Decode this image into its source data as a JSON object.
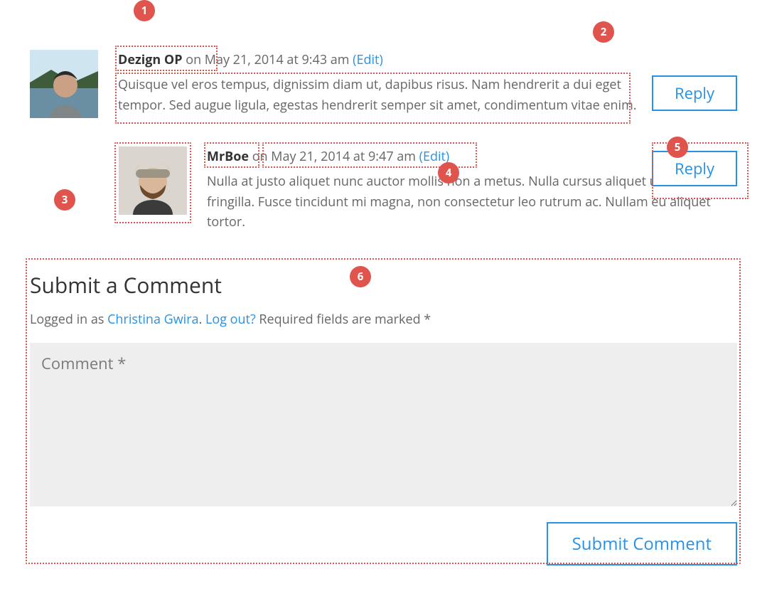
{
  "comments": [
    {
      "author": "Dezign OP",
      "date": "on May 21, 2014 at 9:43 am",
      "edit": "(Edit)",
      "body": "Quisque vel eros tempus, dignissim diam ut, dapibus risus. Nam hendrerit a dui eget tempor. Sed augue ligula, egestas hendrerit semper sit amet, condimentum vitae enim.",
      "reply": "Reply"
    },
    {
      "author": "MrBoe",
      "date": "on May 21, 2014 at 9:47 am",
      "edit": "(Edit)",
      "body": "Nulla at justo aliquet nunc auctor mollis non a metus. Nulla cursus aliquet urna in fringilla. Fusce tincidunt mi magna, non consectetur leo rutrum ac. Nullam eu aliquet tortor.",
      "reply": "Reply"
    }
  ],
  "form": {
    "title": "Submit a Comment",
    "login_pre": "Logged in as ",
    "user_link": "Christina Gwira",
    "sep": ". ",
    "logout": "Log out?",
    "required": " Required fields are marked *",
    "placeholder": "Comment *",
    "submit": "Submit Comment"
  },
  "labels": {
    "n1": "1",
    "n2": "2",
    "n3": "3",
    "n4": "4",
    "n5": "5",
    "n6": "6"
  }
}
